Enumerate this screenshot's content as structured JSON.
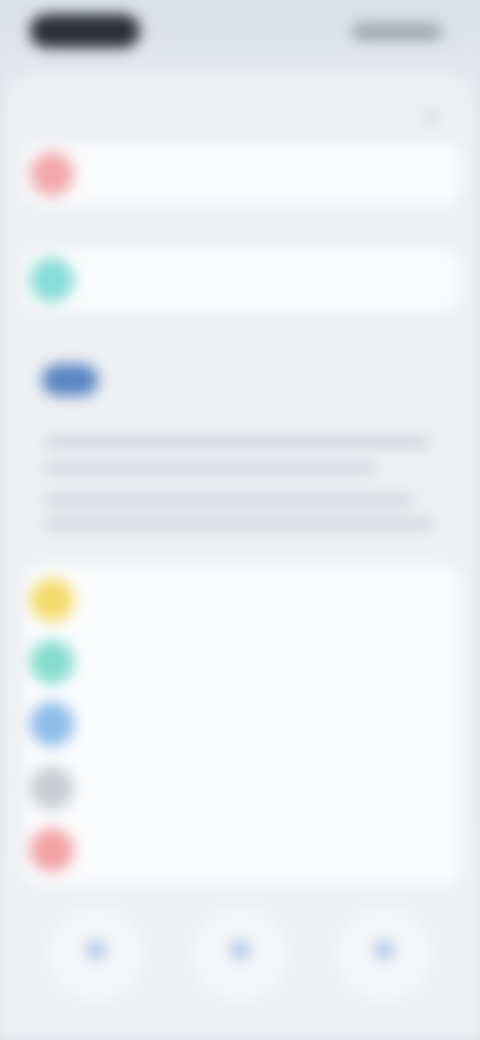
{
  "status_bar": {
    "time": "",
    "indicators": ""
  },
  "sheet": {
    "title": "",
    "close_icon": "close-icon"
  },
  "rows_top": [
    {
      "label": "",
      "icon_color": "#f3a9ac"
    },
    {
      "label": "",
      "icon_color": "#86ddd8"
    }
  ],
  "section": {
    "title": "",
    "icon_color": "#5a86c4",
    "description": ""
  },
  "rows_list": [
    {
      "label": "",
      "icon_color": "#f4dc6e"
    },
    {
      "label": "",
      "icon_color": "#86ddd0"
    },
    {
      "label": "",
      "icon_color": "#8fbdec"
    },
    {
      "label": "",
      "icon_color": "#c9cdd2"
    },
    {
      "label": "",
      "icon_color": "#f3a3a6"
    }
  ],
  "tabs": [
    {
      "label": "",
      "icon": "person-icon"
    },
    {
      "label": "",
      "icon": "person-icon"
    },
    {
      "label": "",
      "icon": "person-icon"
    }
  ]
}
